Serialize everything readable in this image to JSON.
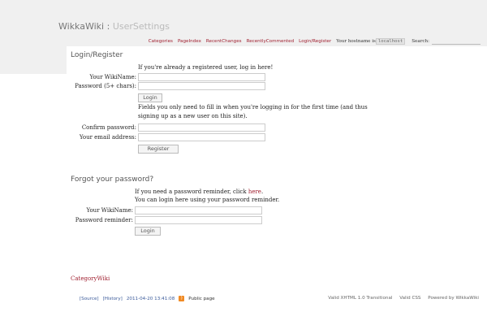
{
  "header": {
    "site_name": "WikkaWiki",
    "separator": ":",
    "page_name": "UserSettings"
  },
  "nav": {
    "categories": "Categories",
    "page_index": "PageIndex",
    "recent_changes": "RecentChanges",
    "recently_commented": "RecentlyCommented",
    "login_register": "Login/Register",
    "hostname_label": "Your hostname is",
    "hostname_value": "localhost",
    "search_label": "Search:"
  },
  "login": {
    "heading": "Login/Register",
    "intro": "If you're already a registered user, log in here!",
    "wikiname_label": "Your WikiName:",
    "password_label": "Password (5+ chars):",
    "login_button": "Login",
    "new_user_line1": "Fields you only need to fill in when you're logging in for the first time (and thus",
    "new_user_line2": "signing up as a new user on this site).",
    "confirm_label": "Confirm password:",
    "email_label": "Your email address:",
    "register_button": "Register"
  },
  "forgot": {
    "heading": "Forgot your password?",
    "line1_pre": "If you need a password reminder, click",
    "line1_link": "here",
    "line1_post": ".",
    "line2": "You can login here using your password reminder.",
    "wikiname_label": "Your WikiName:",
    "reminder_label": "Password reminder:",
    "login_button": "Login"
  },
  "category_link": "CategoryWiki",
  "footer": {
    "source": "[Source]",
    "history": "[History]",
    "timestamp": "2011-04-20 13:41:08",
    "rss": "RSS",
    "public": "Public page",
    "valid_xhtml": "Valid XHTML 1.0 Transitional",
    "valid_css": "Valid CSS",
    "powered": "Powered by WikkaWiki"
  }
}
